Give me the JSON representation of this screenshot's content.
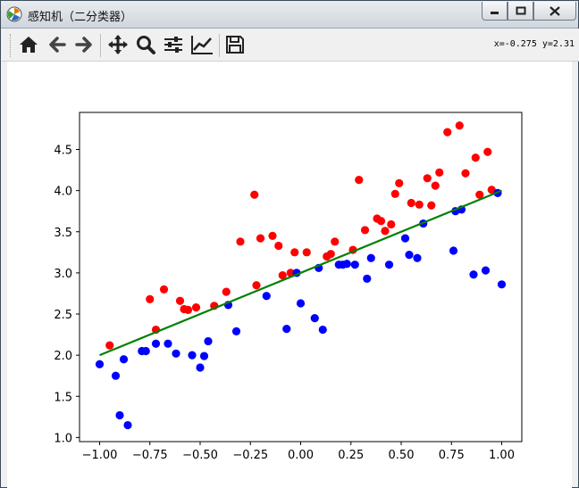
{
  "window": {
    "title": "感知机（二分类器）",
    "icon": "matplotlib-icon",
    "controls": [
      "minimize-icon",
      "maximize-icon",
      "close-icon"
    ]
  },
  "toolbar": {
    "buttons": [
      {
        "name": "home",
        "icon": "home-icon"
      },
      {
        "name": "back",
        "icon": "arrow-left-icon"
      },
      {
        "name": "forward",
        "icon": "arrow-right-icon"
      },
      {
        "name": "pan",
        "icon": "move-icon"
      },
      {
        "name": "zoom",
        "icon": "magnifier-icon"
      },
      {
        "name": "subplots",
        "icon": "sliders-icon"
      },
      {
        "name": "edit-axis",
        "icon": "line-chart-icon"
      },
      {
        "name": "save",
        "icon": "floppy-icon"
      }
    ],
    "coords": "x=-0.275 y=2.31"
  },
  "chart_data": {
    "type": "scatter",
    "xlim": [
      -1.1,
      1.1
    ],
    "ylim": [
      0.95,
      4.95
    ],
    "xticks": [
      -1.0,
      -0.75,
      -0.5,
      -0.25,
      0.0,
      0.25,
      0.5,
      0.75,
      1.0
    ],
    "xtick_labels": [
      "−1.00",
      "−0.75",
      "−0.50",
      "−0.25",
      "0.00",
      "0.25",
      "0.50",
      "0.75",
      "1.00"
    ],
    "yticks": [
      1.0,
      1.5,
      2.0,
      2.5,
      3.0,
      3.5,
      4.0,
      4.5
    ],
    "ytick_labels": [
      "1.0",
      "1.5",
      "2.0",
      "2.5",
      "3.0",
      "3.5",
      "4.0",
      "4.5"
    ],
    "grid": false,
    "colors": {
      "class_a": "#ff0000",
      "class_b": "#0000ff",
      "line": "#008000"
    },
    "series": [
      {
        "color": "#ff0000",
        "points": [
          [
            -0.95,
            2.12
          ],
          [
            -0.75,
            2.68
          ],
          [
            -0.72,
            2.31
          ],
          [
            -0.68,
            2.8
          ],
          [
            -0.6,
            2.66
          ],
          [
            -0.58,
            2.56
          ],
          [
            -0.56,
            2.55
          ],
          [
            -0.52,
            2.58
          ],
          [
            -0.43,
            2.6
          ],
          [
            -0.37,
            2.77
          ],
          [
            -0.3,
            3.38
          ],
          [
            -0.23,
            3.95
          ],
          [
            -0.22,
            2.85
          ],
          [
            -0.2,
            3.42
          ],
          [
            -0.14,
            3.45
          ],
          [
            -0.11,
            3.33
          ],
          [
            -0.09,
            2.97
          ],
          [
            -0.05,
            3.0
          ],
          [
            -0.03,
            3.25
          ],
          [
            0.03,
            3.25
          ],
          [
            0.13,
            3.2
          ],
          [
            0.15,
            3.23
          ],
          [
            0.17,
            3.38
          ],
          [
            0.26,
            3.28
          ],
          [
            0.29,
            4.13
          ],
          [
            0.32,
            3.52
          ],
          [
            0.38,
            3.66
          ],
          [
            0.4,
            3.63
          ],
          [
            0.42,
            3.51
          ],
          [
            0.45,
            3.59
          ],
          [
            0.47,
            3.96
          ],
          [
            0.49,
            4.09
          ],
          [
            0.55,
            3.85
          ],
          [
            0.59,
            3.83
          ],
          [
            0.63,
            4.15
          ],
          [
            0.65,
            3.82
          ],
          [
            0.67,
            4.06
          ],
          [
            0.69,
            4.22
          ],
          [
            0.73,
            4.71
          ],
          [
            0.79,
            4.79
          ],
          [
            0.82,
            4.21
          ],
          [
            0.87,
            4.4
          ],
          [
            0.89,
            3.95
          ],
          [
            0.93,
            4.47
          ],
          [
            0.95,
            4.01
          ]
        ]
      },
      {
        "color": "#0000ff",
        "points": [
          [
            -1.0,
            1.89
          ],
          [
            -0.92,
            1.75
          ],
          [
            -0.9,
            1.27
          ],
          [
            -0.88,
            1.95
          ],
          [
            -0.86,
            1.15
          ],
          [
            -0.79,
            2.05
          ],
          [
            -0.77,
            2.05
          ],
          [
            -0.72,
            2.14
          ],
          [
            -0.66,
            2.14
          ],
          [
            -0.62,
            2.02
          ],
          [
            -0.54,
            2.0
          ],
          [
            -0.5,
            1.85
          ],
          [
            -0.48,
            1.99
          ],
          [
            -0.46,
            2.17
          ],
          [
            -0.36,
            2.61
          ],
          [
            -0.32,
            2.29
          ],
          [
            -0.17,
            2.72
          ],
          [
            -0.07,
            2.32
          ],
          [
            -0.02,
            3.0
          ],
          [
            0.0,
            2.63
          ],
          [
            0.07,
            2.45
          ],
          [
            0.09,
            3.06
          ],
          [
            0.11,
            2.31
          ],
          [
            0.19,
            3.1
          ],
          [
            0.21,
            3.1
          ],
          [
            0.23,
            3.11
          ],
          [
            0.27,
            3.1
          ],
          [
            0.33,
            2.93
          ],
          [
            0.35,
            3.18
          ],
          [
            0.44,
            3.1
          ],
          [
            0.52,
            3.42
          ],
          [
            0.54,
            3.22
          ],
          [
            0.58,
            3.18
          ],
          [
            0.61,
            3.6
          ],
          [
            0.76,
            3.27
          ],
          [
            0.77,
            3.75
          ],
          [
            0.8,
            3.77
          ],
          [
            0.86,
            2.98
          ],
          [
            0.92,
            3.03
          ],
          [
            0.98,
            3.97
          ],
          [
            1.0,
            2.86
          ]
        ]
      }
    ],
    "line": {
      "x": [
        -1.0,
        1.0
      ],
      "y": [
        2.0,
        4.0
      ]
    }
  }
}
